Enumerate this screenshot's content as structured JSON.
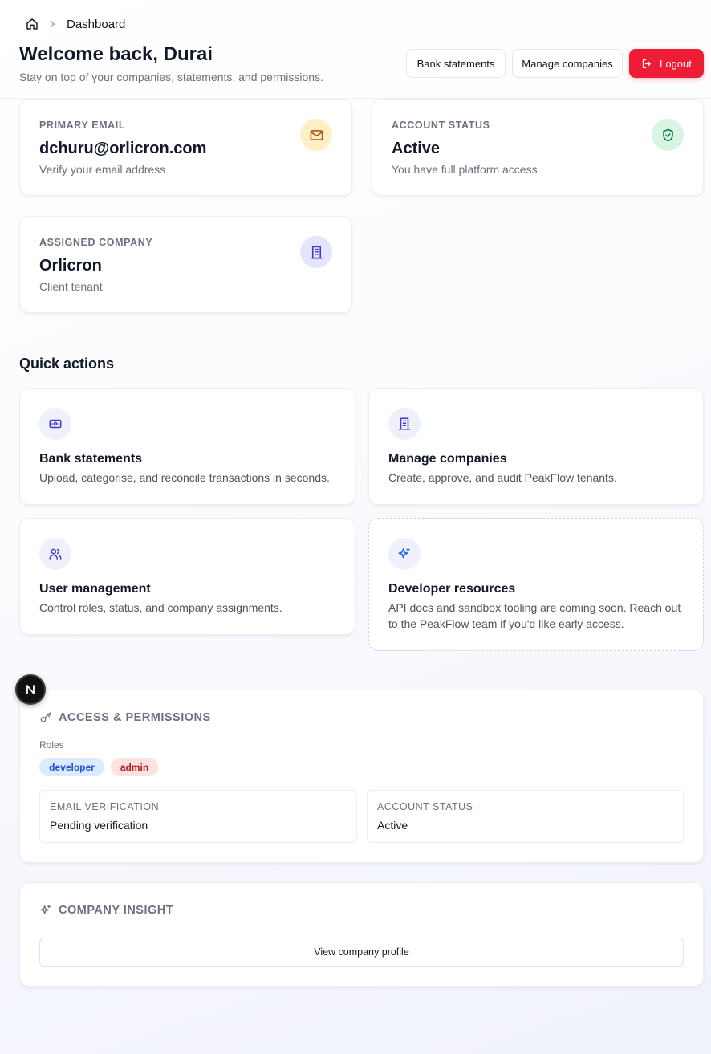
{
  "breadcrumb": {
    "home_icon": "home-icon",
    "current": "Dashboard"
  },
  "header": {
    "title": "Welcome back, Durai",
    "subtitle": "Stay on top of your companies, statements, and permissions.",
    "buttons": {
      "bank_statements": "Bank statements",
      "manage_companies": "Manage companies",
      "logout": "Logout"
    }
  },
  "stats": [
    {
      "label": "PRIMARY EMAIL",
      "value": "dchuru@orlicron.com",
      "sub": "Verify your email address",
      "icon": "mail-icon",
      "icon_color": "#b45309",
      "icon_bg": "#fdf0c4"
    },
    {
      "label": "ACCOUNT STATUS",
      "value": "Active",
      "sub": "You have full platform access",
      "icon": "shield-check-icon",
      "icon_color": "#15803d",
      "icon_bg": "#d8f5e3"
    },
    {
      "label": "ASSIGNED COMPANY",
      "value": "Orlicron",
      "sub": "Client tenant",
      "icon": "building-icon",
      "icon_color": "#4338ca",
      "icon_bg": "#e3e6fa"
    }
  ],
  "quick_actions": {
    "title": "Quick actions",
    "items": [
      {
        "title": "Bank statements",
        "desc": "Upload, categorise, and reconcile transactions in seconds.",
        "icon": "banknote-icon"
      },
      {
        "title": "Manage companies",
        "desc": "Create, approve, and audit PeakFlow tenants.",
        "icon": "building-icon"
      },
      {
        "title": "User management",
        "desc": "Control roles, status, and company assignments.",
        "icon": "users-icon"
      },
      {
        "title": "Developer resources",
        "desc": "API docs and sandbox tooling are coming soon. Reach out to the PeakFlow team if you'd like early access.",
        "icon": "sparkles-icon"
      }
    ]
  },
  "badge": {
    "letter": "N"
  },
  "access": {
    "title": "ACCESS & PERMISSIONS",
    "icon": "key-icon",
    "roles_label": "Roles",
    "roles": [
      "developer",
      "admin"
    ],
    "email_verification": {
      "label": "EMAIL VERIFICATION",
      "value": "Pending verification"
    },
    "account_status": {
      "label": "ACCOUNT STATUS",
      "value": "Active"
    }
  },
  "insight": {
    "title": "COMPANY INSIGHT",
    "icon": "sparkles-icon",
    "button": "View company profile"
  }
}
